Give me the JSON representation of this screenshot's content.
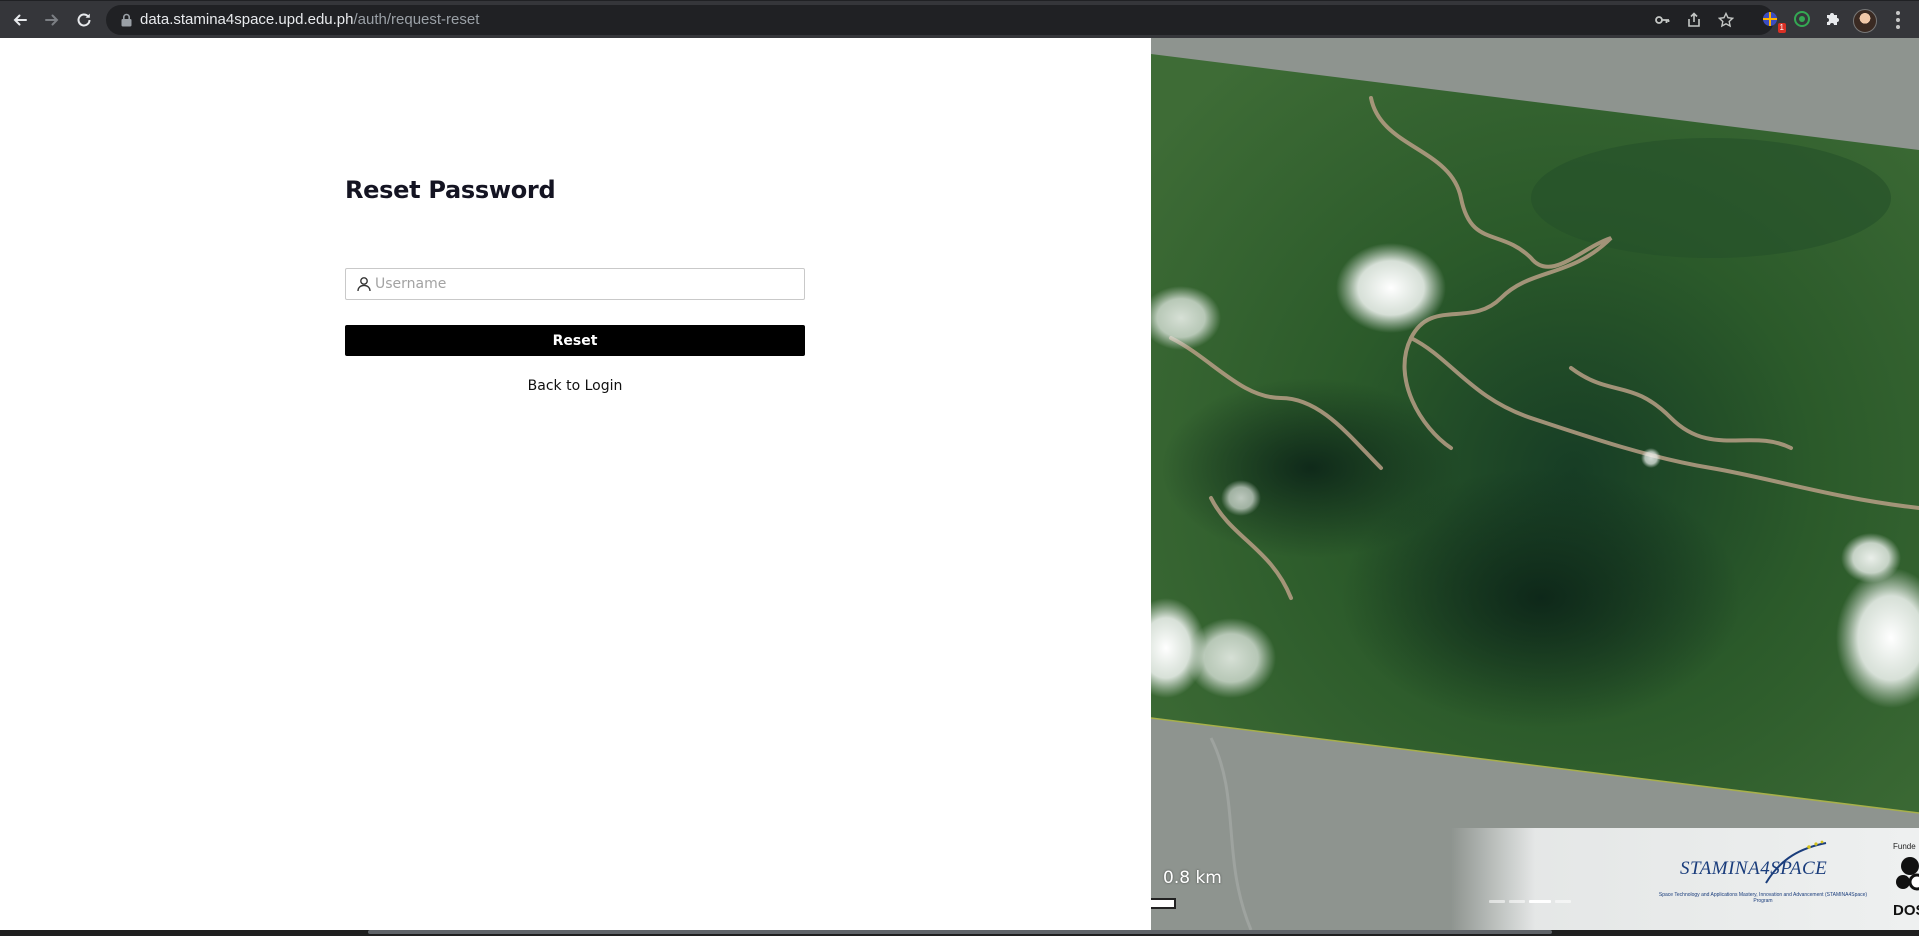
{
  "browser": {
    "url_host": "data.stamina4space.upd.edu.ph",
    "url_path": "/auth/request-reset",
    "extension_badge": "1"
  },
  "form": {
    "title": "Reset Password",
    "username_placeholder": "Username",
    "username_value": "",
    "reset_label": "Reset",
    "back_label": "Back to Login"
  },
  "map_panel": {
    "scale_label": "0.8 km",
    "carousel": {
      "count": 4,
      "active_index": 2
    },
    "logo": {
      "name": "STAMINA4SPACE",
      "subtitle": "Space Technology and Applications Mastery, Innovation and Advancement (STAMINA4Space) Program"
    },
    "funder_label": "Funde",
    "funder_name": "DOS"
  },
  "colors": {
    "button_bg": "#000000",
    "title_text": "#141422",
    "chrome_bg": "#35363a",
    "omnibox_bg": "#202124",
    "logo_blue": "#1a3d7c"
  },
  "icons": [
    "back-arrow-icon",
    "forward-arrow-icon",
    "reload-icon",
    "lock-icon",
    "key-icon",
    "share-icon",
    "star-icon",
    "extension-icon",
    "puzzle-icon",
    "menu-icon",
    "user-icon"
  ]
}
